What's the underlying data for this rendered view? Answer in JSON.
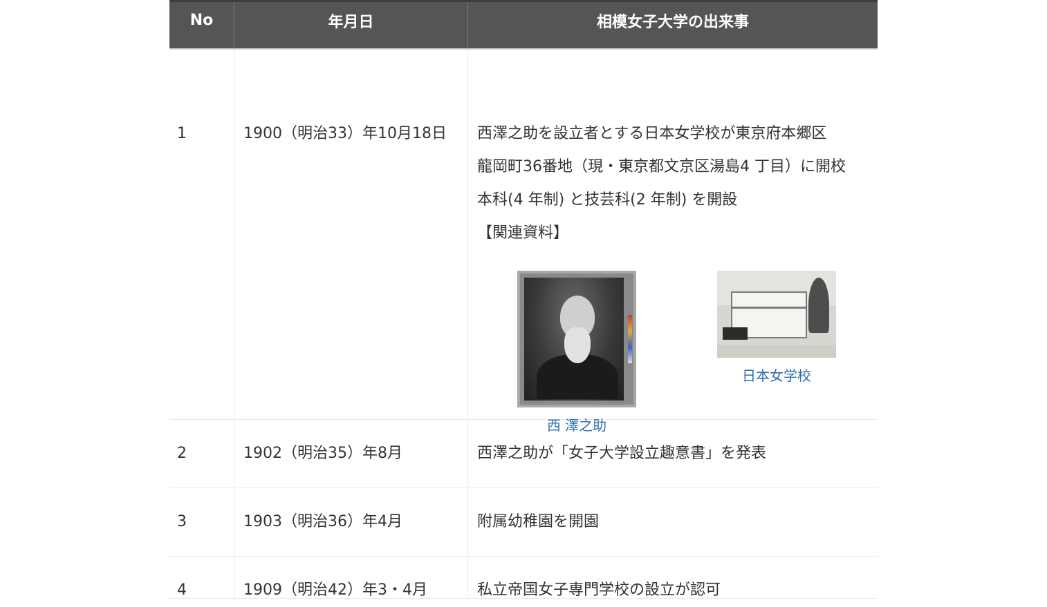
{
  "table": {
    "headers": {
      "no": "No",
      "date": "年月日",
      "event": "相模女子大学の出来事"
    },
    "rows": [
      {
        "no": "1",
        "date": "1900（明治33）年10月18日",
        "event_lines": [
          "西澤之助を設立者とする日本女学校が東京府本郷区",
          "龍岡町36番地（現・東京都文京区湯島4 丁目）に開校",
          "本科(4 年制) と技芸科(2 年制) を開設",
          "【関連資料】"
        ],
        "materials": [
          {
            "caption": "西 澤之助",
            "image": "portrait-photo"
          },
          {
            "caption": "日本女学校",
            "image": "school-building-photo"
          }
        ]
      },
      {
        "no": "2",
        "date": "1902（明治35）年8月",
        "event": "西澤之助が「女子大学設立趣意書」を発表"
      },
      {
        "no": "3",
        "date": "1903（明治36）年4月",
        "event": "附属幼稚園を開園"
      },
      {
        "no": "4",
        "date": "1909（明治42）年3・4月",
        "event": "私立帝国女子専門学校の設立が認可"
      }
    ]
  },
  "colors": {
    "header_bg": "#555555",
    "link": "#2f6fb0",
    "border": "#e8e8e8"
  }
}
